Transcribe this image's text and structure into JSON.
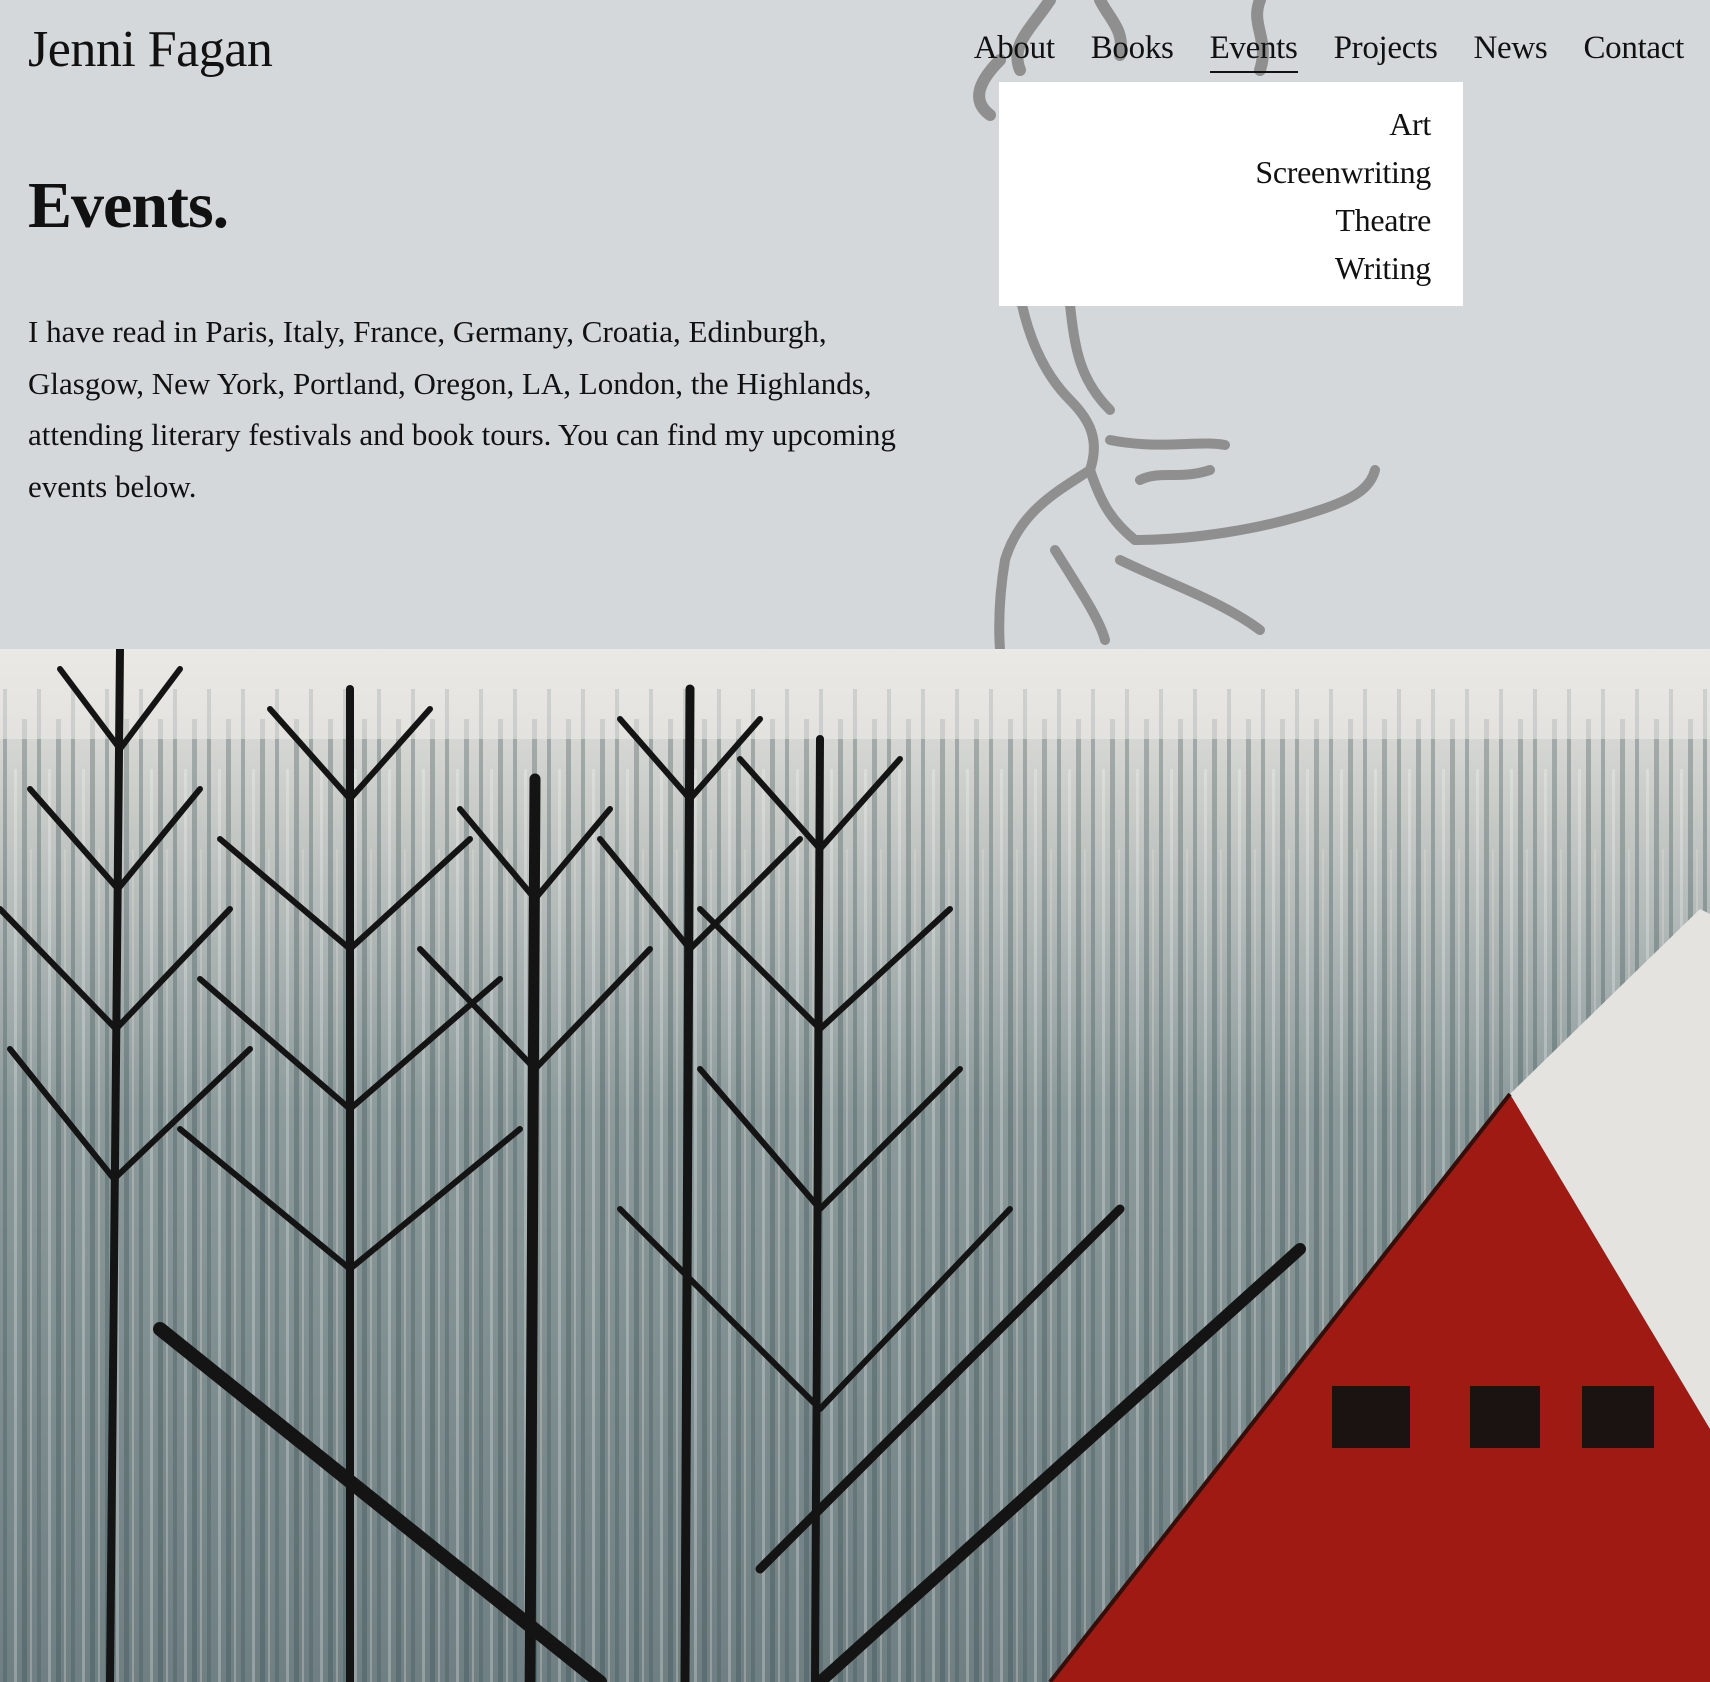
{
  "site": {
    "title": "Jenni Fagan"
  },
  "nav": {
    "items": [
      {
        "label": "About"
      },
      {
        "label": "Books"
      },
      {
        "label": "Events"
      },
      {
        "label": "Projects"
      },
      {
        "label": "News"
      },
      {
        "label": "Contact"
      }
    ],
    "active": "Events"
  },
  "projects_dropdown": {
    "items": [
      {
        "label": "Art"
      },
      {
        "label": "Screenwriting"
      },
      {
        "label": "Theatre"
      },
      {
        "label": "Writing"
      }
    ]
  },
  "main": {
    "heading": "Events.",
    "intro": "I have read in Paris, Italy, France, Germany, Croatia, Edinburgh, Glasgow, New York, Portland, Oregon, LA, London, the Highlands, attending literary festivals and book tours. You can find my upcoming events below."
  },
  "colors": {
    "background": "#d4d8db",
    "dropdown_background": "#ffffff",
    "text": "#111111",
    "barn_red": "#9e1a12"
  },
  "icons": [
    "figure-sketch",
    "painted-forest-banner"
  ]
}
